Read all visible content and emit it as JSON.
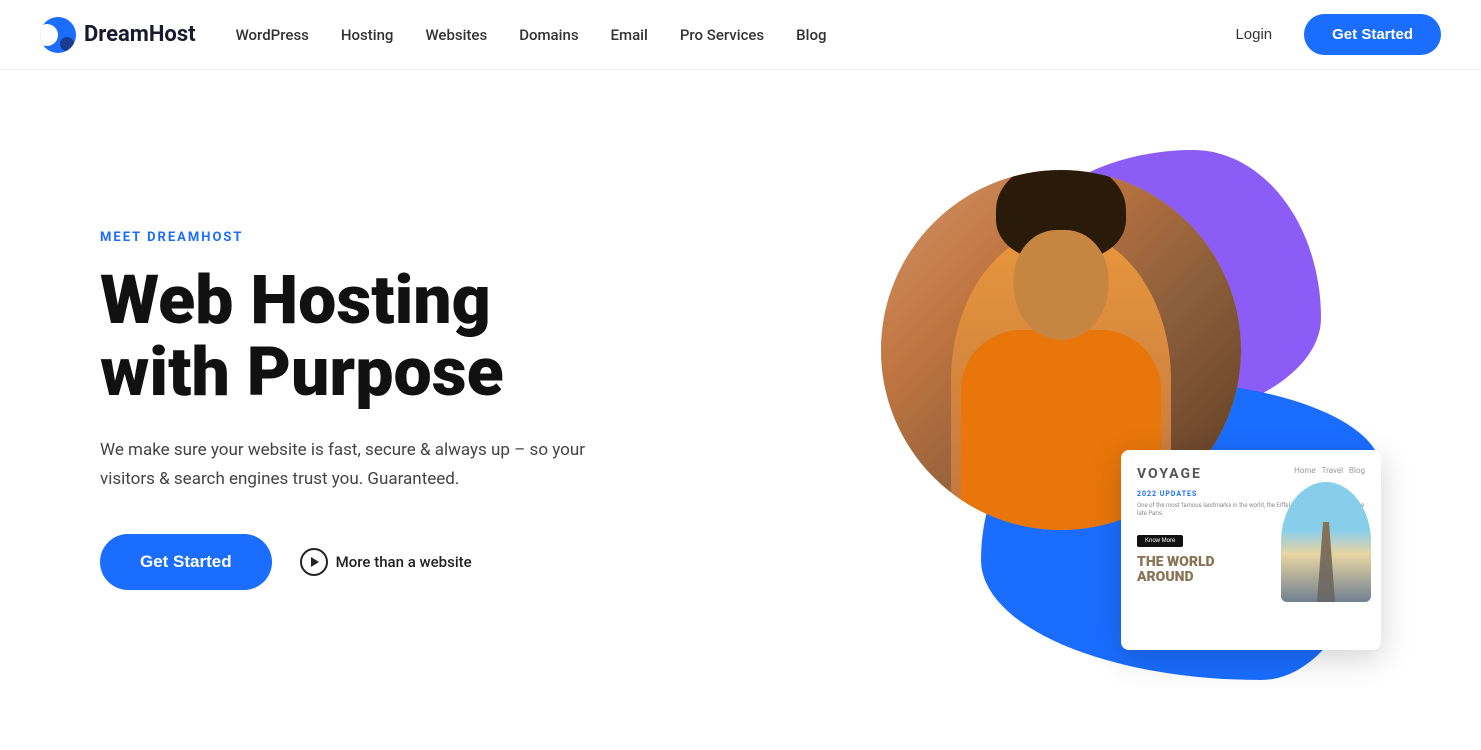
{
  "nav": {
    "logo_text": "DreamHost",
    "items": [
      {
        "label": "WordPress",
        "id": "wordpress"
      },
      {
        "label": "Hosting",
        "id": "hosting"
      },
      {
        "label": "Websites",
        "id": "websites"
      },
      {
        "label": "Domains",
        "id": "domains"
      },
      {
        "label": "Email",
        "id": "email"
      },
      {
        "label": "Pro Services",
        "id": "pro-services"
      },
      {
        "label": "Blog",
        "id": "blog"
      }
    ],
    "login": "Login",
    "get_started": "Get Started"
  },
  "hero": {
    "eyebrow": "MEET DREAMHOST",
    "title_line1": "Web Hosting",
    "title_line2": "with Purpose",
    "subtitle": "We make sure your website is fast, secure & always up – so your visitors & search engines trust you. Guaranteed.",
    "cta_primary": "Get Started",
    "cta_secondary": "More than a website"
  },
  "website_card": {
    "title": "VOYAGE",
    "nav_items": [
      "Home",
      "Travel",
      "Blog"
    ],
    "section_label": "2022 UPDATES",
    "body_text": "One of the most famous landmarks in the world, the Eiffel Tower (in Tour Eiffel) by the late Paris.",
    "know_more": "Know More",
    "big_text_line1": "THE WORLD",
    "big_text_line2": "AROUND"
  },
  "colors": {
    "primary_blue": "#1a6dff",
    "purple": "#8B5CF6",
    "eyebrow_blue": "#1a6dff"
  }
}
